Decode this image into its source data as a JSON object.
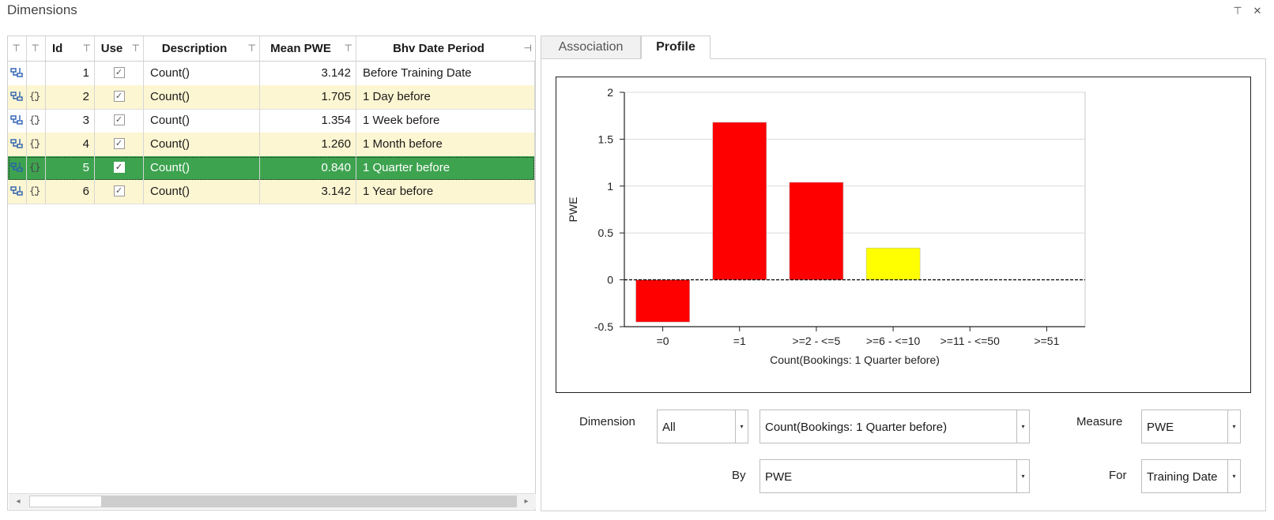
{
  "window": {
    "title": "Dimensions",
    "pin_glyph": "⊤",
    "close_glyph": "✕"
  },
  "grid": {
    "columns": [
      {
        "label": ""
      },
      {
        "label": ""
      },
      {
        "label": "Id"
      },
      {
        "label": "Use"
      },
      {
        "label": "Description"
      },
      {
        "label": "Mean PWE"
      },
      {
        "label": "Bhv Date Period"
      }
    ],
    "rows": [
      {
        "id": "1",
        "use": true,
        "description": "Count()",
        "mean_pwe": "3.142",
        "period": "Before Training Date",
        "style": "normal",
        "icons": [
          "link-icon"
        ]
      },
      {
        "id": "2",
        "use": true,
        "description": "Count()",
        "mean_pwe": "1.705",
        "period": "1 Day before",
        "style": "alt",
        "icons": [
          "link-icon",
          "brace-icon"
        ]
      },
      {
        "id": "3",
        "use": true,
        "description": "Count()",
        "mean_pwe": "1.354",
        "period": "1 Week before",
        "style": "normal",
        "icons": [
          "link-icon",
          "brace-icon"
        ]
      },
      {
        "id": "4",
        "use": true,
        "description": "Count()",
        "mean_pwe": "1.260",
        "period": "1 Month before",
        "style": "alt",
        "icons": [
          "link-icon",
          "brace-icon"
        ]
      },
      {
        "id": "5",
        "use": true,
        "description": "Count()",
        "mean_pwe": "0.840",
        "period": "1 Quarter before",
        "style": "sel",
        "icons": [
          "link-icon",
          "brace-icon"
        ]
      },
      {
        "id": "6",
        "use": true,
        "description": "Count()",
        "mean_pwe": "3.142",
        "period": "1 Year before",
        "style": "alt",
        "icons": [
          "link-icon",
          "brace-icon"
        ]
      }
    ],
    "checkmark": "✓",
    "scroll_left": "◂",
    "scroll_right": "▸"
  },
  "tabs": [
    {
      "label": "Association",
      "active": false
    },
    {
      "label": "Profile",
      "active": true
    }
  ],
  "chart_data": {
    "type": "bar",
    "categories": [
      "=0",
      "=1",
      ">=2 - <=5",
      ">=6 - <=10",
      ">=11 - <=50",
      ">=51"
    ],
    "values": [
      -0.45,
      1.68,
      1.04,
      0.34,
      0,
      0
    ],
    "colors": [
      "#ff0000",
      "#ff0000",
      "#ff0000",
      "#ffff00",
      "#ff0000",
      "#ff0000"
    ],
    "ylabel": "PWE",
    "xlabel": "Count(Bookings: 1 Quarter before)",
    "ylim": [
      -0.5,
      2
    ],
    "yticks": [
      -0.5,
      0,
      0.5,
      1,
      1.5,
      2
    ],
    "ytick_labels": [
      "-0.5",
      "0",
      "0.5",
      "1",
      "1.5",
      "2"
    ],
    "grid": true,
    "zero_line": "dashed"
  },
  "controls": {
    "dimension_label": "Dimension",
    "dimension_value": "All",
    "variable_value": "Count(Bookings: 1 Quarter before)",
    "measure_label": "Measure",
    "measure_value": "PWE",
    "by_label": "By",
    "by_value": "PWE",
    "for_label": "For",
    "for_value": "Training Date",
    "dropdown_glyph": "▾"
  }
}
